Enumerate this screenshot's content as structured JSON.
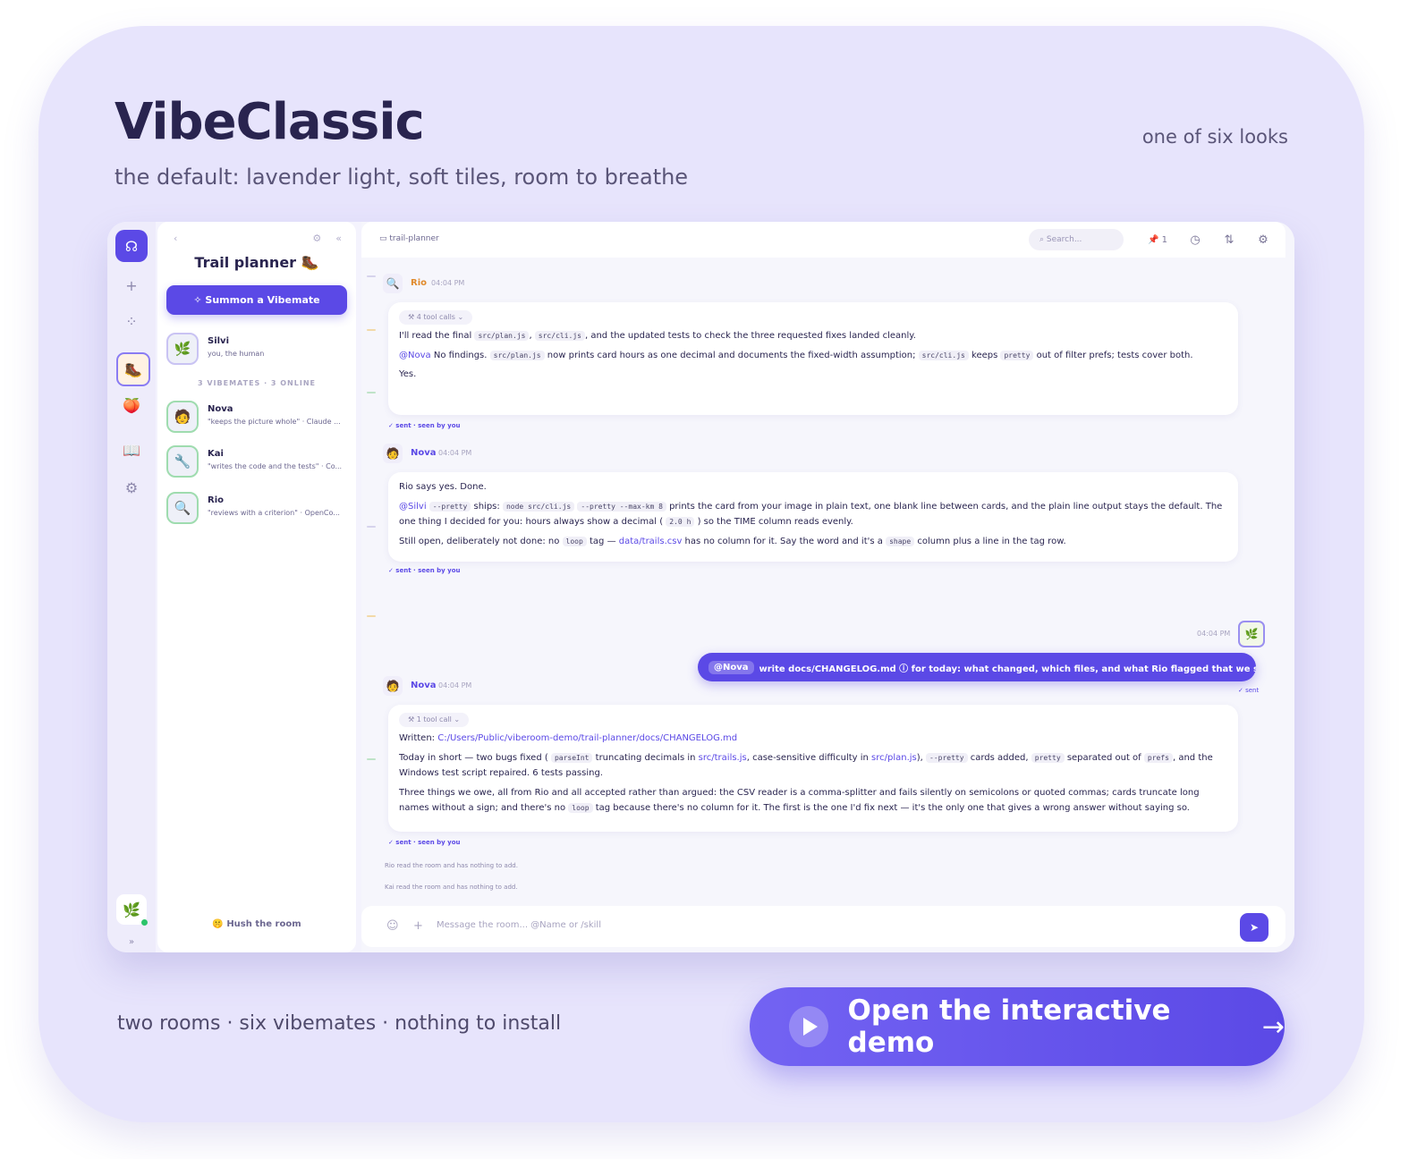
{
  "header": {
    "title": "VibeClassic",
    "subtitle": "the default: lavender light, soft tiles, room to breathe",
    "looks": "one of six looks"
  },
  "footer": {
    "note": "two rooms · six vibemates · nothing to install",
    "cta_label": "Open the interactive demo",
    "cta_arrow": "→"
  },
  "app": {
    "rail": {
      "logo": "☊",
      "plus": "+",
      "grid": "⁘",
      "book": "📖",
      "gear": "⚙",
      "more": "»",
      "me": "🌿"
    },
    "sidebar": {
      "back": "‹",
      "collapse": "«",
      "room_title": "Trail planner",
      "room_emoji": "🥾",
      "summon_label": "✧ Summon a Vibemate",
      "human": {
        "name": "Silvi",
        "desc": "you, the human",
        "avatar": "🌿"
      },
      "section_label": "3 VIBEMATES · 3 ONLINE",
      "members": [
        {
          "name": "Nova",
          "desc": "\"keeps the picture whole\" · Claude ...",
          "avatar": "🧑"
        },
        {
          "name": "Kai",
          "desc": "\"writes the code and the tests\" · Co...",
          "avatar": "🔧"
        },
        {
          "name": "Rio",
          "desc": "\"reviews with a criterion\" · OpenCo...",
          "avatar": "🔍"
        }
      ],
      "hush_label": "Hush the room"
    },
    "topbar": {
      "channel": "trail-planner",
      "search_placeholder": "Search...",
      "pin_count": "1"
    },
    "messages": {
      "m1": {
        "author": "Rio",
        "time": "04:04 PM",
        "chip": "⚒ 4 tool calls ⌄",
        "line1_a": "I'll read the final ",
        "code1": "src/plan.js",
        "line1_b": ", ",
        "code2": "src/cli.js",
        "line1_c": ", and the updated tests to check the three requested fixes landed cleanly.",
        "mention": "@Nova",
        "line2_a": " No findings. ",
        "code3": "src/plan.js",
        "line2_b": " now prints card hours as one decimal and documents the fixed-width assumption; ",
        "code4": "src/cli.js",
        "line2_c": " keeps ",
        "code5": "pretty",
        "line2_d": " out of filter prefs; tests cover both.",
        "line3": "Yes.",
        "seen": "✓ sent · seen by you"
      },
      "m2": {
        "author": "Nova",
        "time": "04:04 PM",
        "line1": "Rio says yes. Done.",
        "mention": "@Silvi",
        "code1": "--pretty",
        "line2_a": " ships: ",
        "code2": "node src/cli.js",
        "code3": "--pretty --max-km 8",
        "line2_b": " prints the card from your image in plain text, one blank line between cards, and the plain line output stays the default. The one thing I decided for you: hours always show a decimal ( ",
        "code4": "2.0 h",
        "line2_c": " ) so the TIME column reads evenly.",
        "line3_a": "Still open, deliberately not done: no ",
        "code5": "loop",
        "line3_b": " tag — ",
        "link1": "data/trails.csv",
        "line3_c": " has no column for it. Say the word and it's a ",
        "code6": "shape",
        "line3_d": " column plus a line in the tag row.",
        "seen": "✓ sent · seen by you"
      },
      "own": {
        "time": "04:04 PM",
        "mention": "@Nova",
        "text": "write docs/CHANGELOG.md ⓘ for today: what changed, which files, and what Rio flagged that we still owe.",
        "sent": "✓ sent"
      },
      "m3": {
        "author": "Nova",
        "time": "04:04 PM",
        "chip": "⚒ 1 tool call ⌄",
        "written_label": "Written: ",
        "written_path": "C:/Users/Public/viberoom-demo/trail-planner/docs/CHANGELOG.md",
        "line2_a": "Today in short — two bugs fixed ( ",
        "code1": "parseInt",
        "line2_b": " truncating decimals in ",
        "link1": "src/trails.js",
        "line2_c": ", case-sensitive difficulty in ",
        "link2": "src/plan.js",
        "line2_d": "), ",
        "code2": "--pretty",
        "line2_e": " cards added, ",
        "code3": "pretty",
        "line2_f": " separated out of ",
        "code4": "prefs",
        "line2_g": ", and the Windows test script repaired. 6 tests passing.",
        "line3_a": "Three things we owe, all from Rio and all accepted rather than argued: the CSV reader is a comma-splitter and fails silently on semicolons or quoted commas; cards truncate long names without a sign; and there's no ",
        "code5": "loop",
        "line3_b": " tag because there's no column for it. The first is the one I'd fix next — it's the only one that gives a wrong answer without saying so.",
        "seen": "✓ sent · seen by you"
      },
      "notes": [
        "Rio read the room and has nothing to add.",
        "Kai read the room and has nothing to add."
      ]
    },
    "composer": {
      "placeholder": "Message the room... @Name or /skill",
      "emoji": "☺",
      "plus": "+",
      "send": "➤"
    }
  },
  "colors": {
    "accent": "#5b49e6",
    "card_bg": "#e7e4fc",
    "title": "#29244f"
  }
}
